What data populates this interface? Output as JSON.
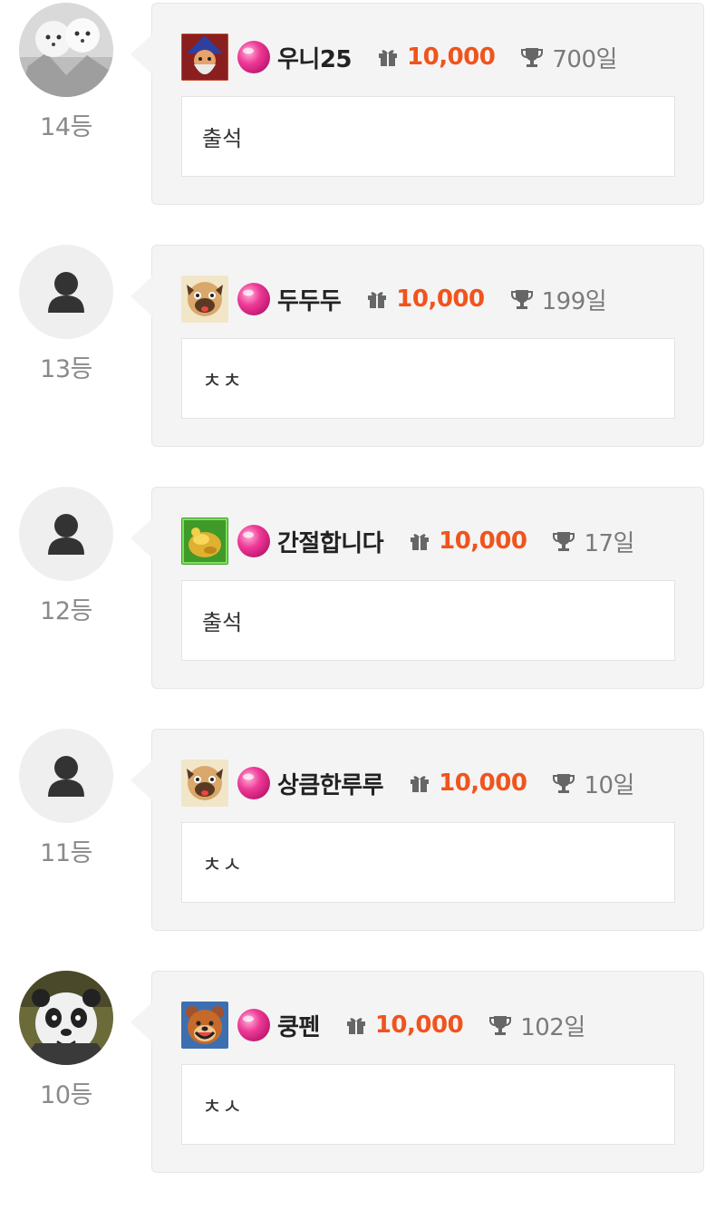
{
  "colors": {
    "points": "#f0541d",
    "bubble_bg": "#f4f4f4",
    "rank_text": "#8a8a8a",
    "candy": "#ee3a96"
  },
  "entries": [
    {
      "rank": "14등",
      "avatar": "photo-two-white-dogs",
      "game_icon": "wizard-character-icon",
      "level_icon": "pink-candy-icon",
      "nickname": "우니25",
      "points": "10,000",
      "streak": "700일",
      "comment": "출석"
    },
    {
      "rank": "13등",
      "avatar": "default-user-icon",
      "game_icon": "pug-dog-icon",
      "level_icon": "pink-candy-icon",
      "nickname": "두두두",
      "points": "10,000",
      "streak": "199일",
      "comment": "ㅊㅊ"
    },
    {
      "rank": "12등",
      "avatar": "default-user-icon",
      "game_icon": "gold-treasure-icon",
      "level_icon": "pink-candy-icon",
      "nickname": "간절합니다",
      "points": "10,000",
      "streak": "17일",
      "comment": "출석"
    },
    {
      "rank": "11등",
      "avatar": "default-user-icon",
      "game_icon": "pug-dog-icon",
      "level_icon": "pink-candy-icon",
      "nickname": "상큼한루루",
      "points": "10,000",
      "streak": "10일",
      "comment": "ㅊㅅ"
    },
    {
      "rank": "10등",
      "avatar": "photo-panda",
      "game_icon": "bear-character-icon",
      "level_icon": "pink-candy-icon",
      "nickname": "쿵펜",
      "points": "10,000",
      "streak": "102일",
      "comment": "ㅊㅅ"
    }
  ]
}
